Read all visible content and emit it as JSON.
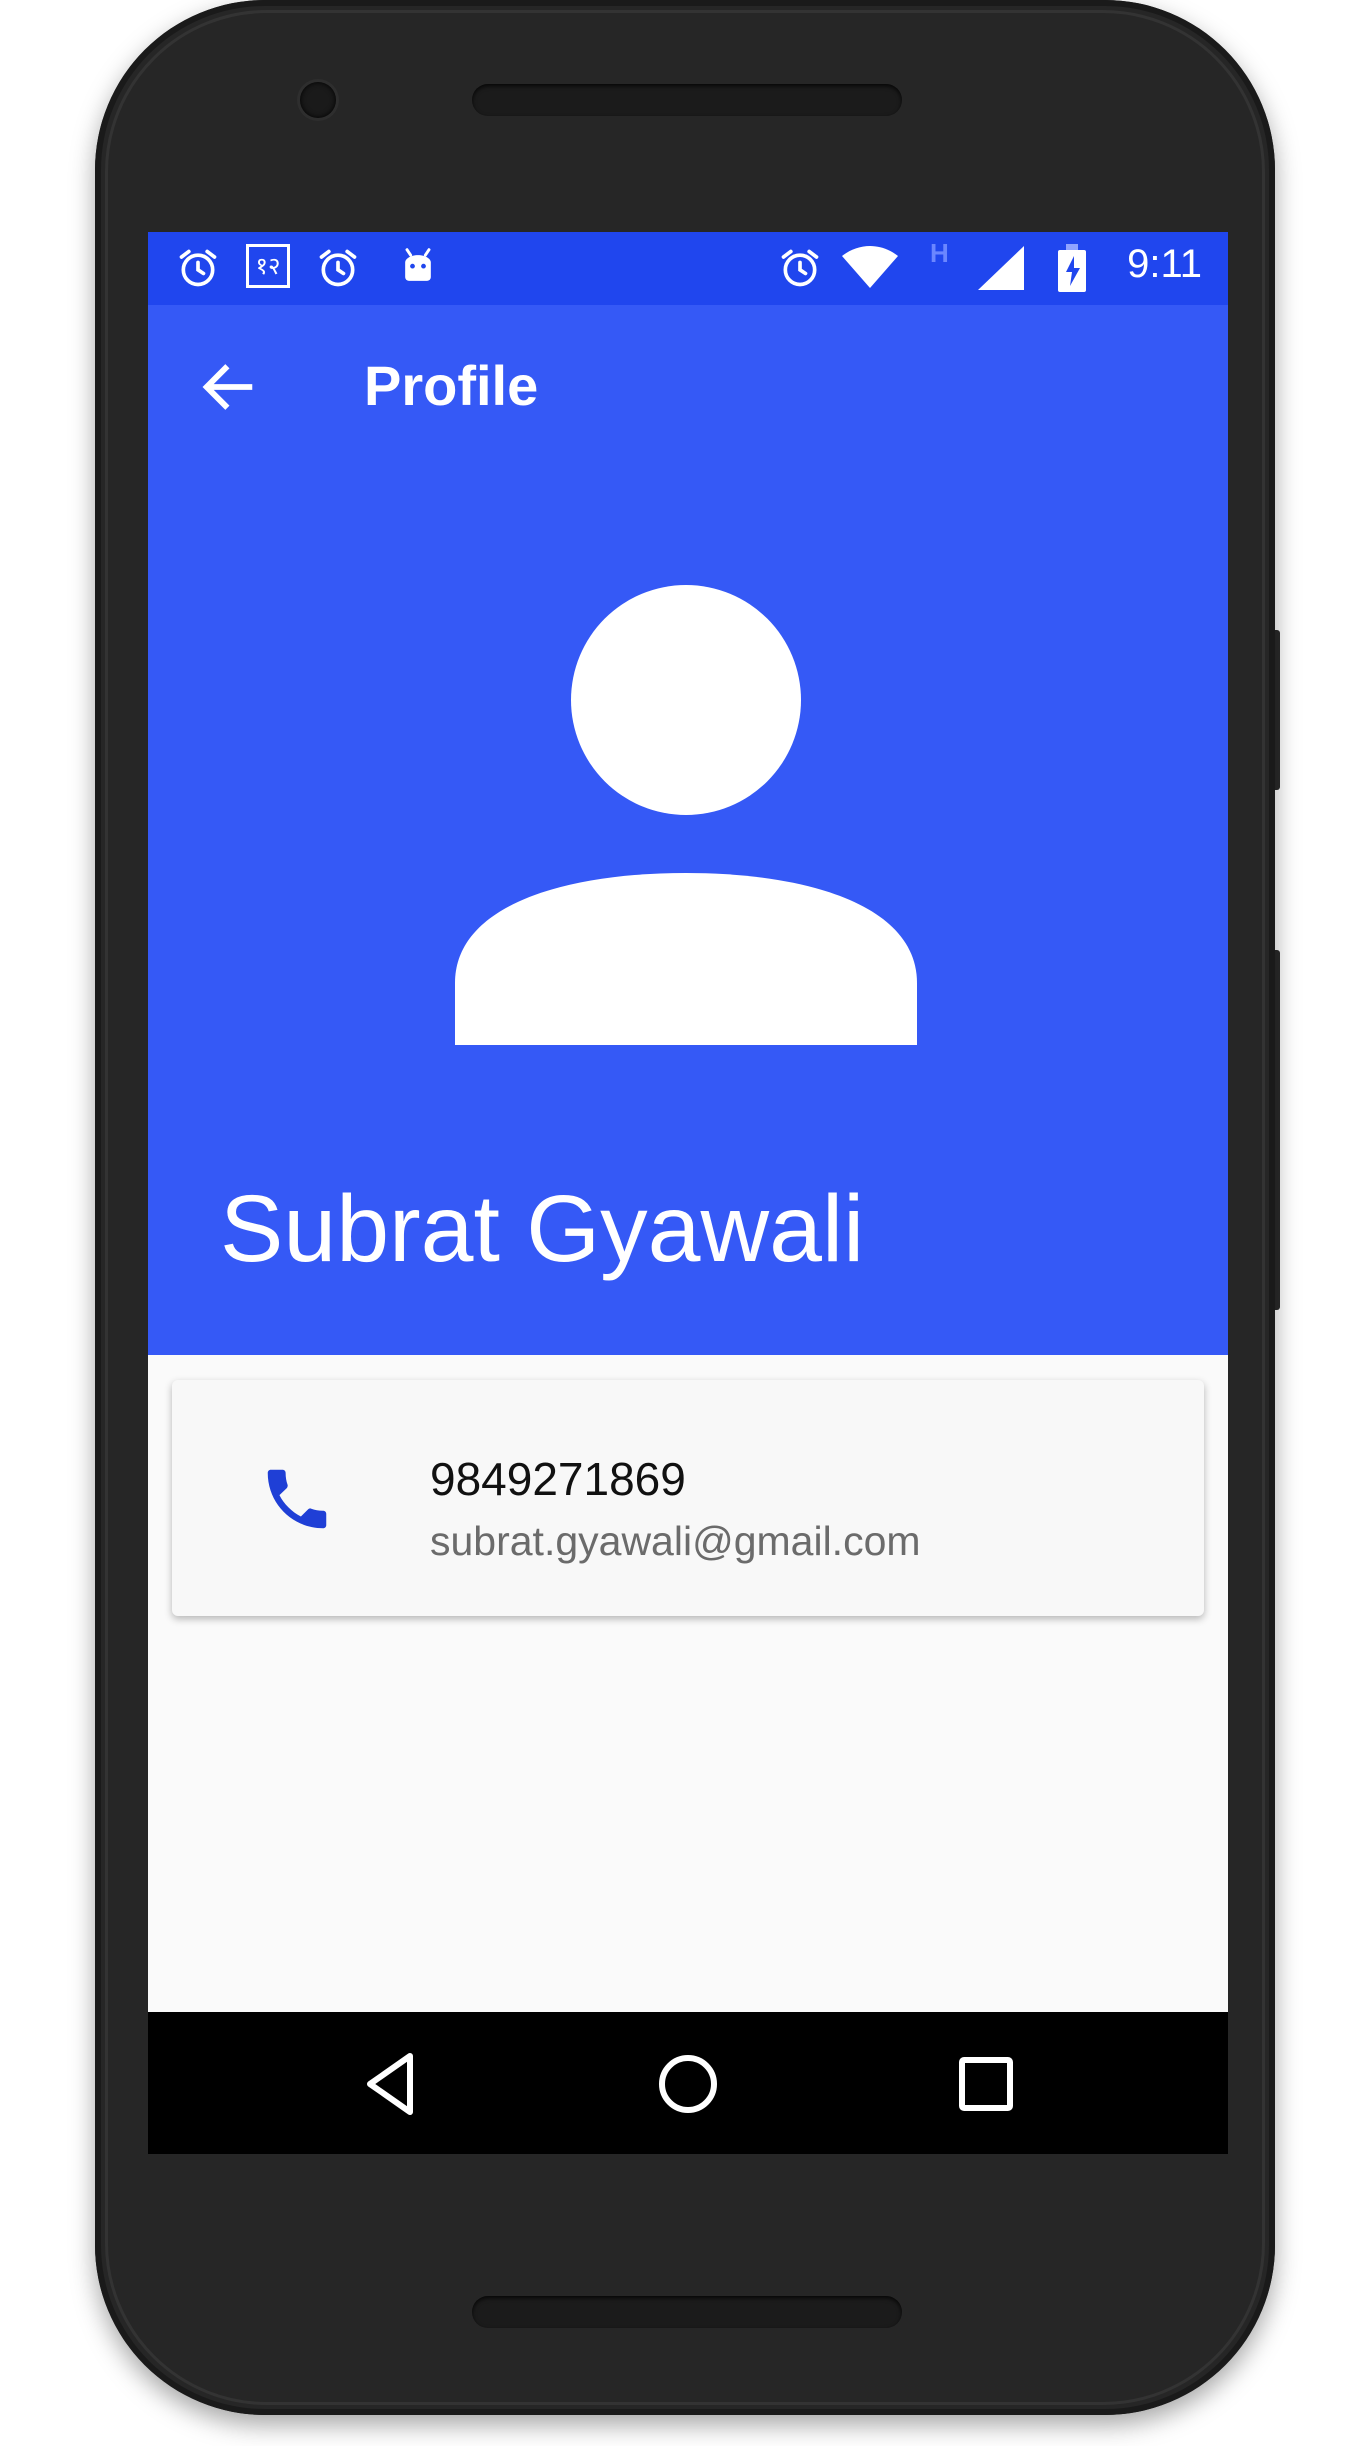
{
  "status_bar": {
    "time": "9:11",
    "left_icons": [
      "alarm-icon",
      "keyboard-lang-icon",
      "alarm-icon",
      "android-debug-icon"
    ],
    "right_icons": [
      "alarm-icon",
      "wifi-icon",
      "network-type-icon",
      "signal-icon",
      "battery-charging-icon"
    ],
    "network_type": "H",
    "lang_badge": "१२",
    "background_color": "#2046ee"
  },
  "toolbar": {
    "title": "Profile",
    "back_icon": "arrow-back-icon"
  },
  "profile": {
    "name": "Subrat Gyawali",
    "avatar_icon": "person-placeholder-icon",
    "header_color": "#3559f6"
  },
  "contact": {
    "phone_icon": "phone-icon",
    "phone": "9849271869",
    "email": "subrat.gyawali@gmail.com",
    "accent_color": "#1f3fd6"
  },
  "nav_bar": {
    "back": "nav-back-icon",
    "home": "nav-home-icon",
    "recents": "nav-recents-icon"
  }
}
